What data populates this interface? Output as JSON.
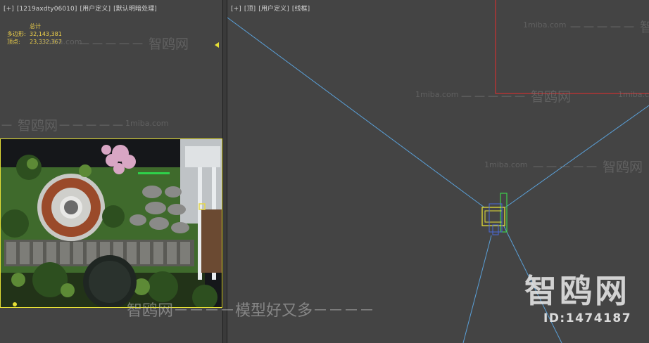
{
  "left_viewport": {
    "label_parts": [
      "[+]",
      "[1219axdty06010]",
      "[用户定义]",
      "[默认明暗处理]"
    ],
    "stats": {
      "title": "总计",
      "polygons_label": "多边形:",
      "polygons_value": "32,143,381",
      "vertices_label": "顶点:",
      "vertices_value": "23,332,367"
    }
  },
  "right_viewport": {
    "label_parts": [
      "[+]",
      "[顶]",
      "[用户定义]",
      "[线框]"
    ]
  },
  "watermarks": {
    "site": "1miba.com",
    "dash_brand": "－－－－－ 智鸥网",
    "brand_line": "－ 智鸥网－－－－－",
    "bottom": "智鸥网－－－－模型好又多－－－－",
    "big": "智鸥网",
    "id": "ID:1474187"
  },
  "colors": {
    "viewport_bg": "#444444",
    "selection_outline": "#e6e036",
    "camera_lines": "#5aa0d8",
    "red_shape": "#c83232",
    "stats_text": "#f0d24a"
  }
}
